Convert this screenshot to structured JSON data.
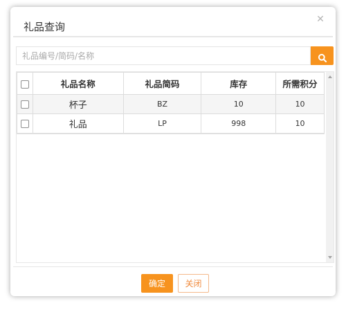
{
  "dialog": {
    "title": "礼品查询",
    "close_icon": "close-icon"
  },
  "search": {
    "placeholder": "礼品编号/简码/名称",
    "value": "",
    "button_icon": "search-icon"
  },
  "table": {
    "headers": {
      "name": "礼品名称",
      "code": "礼品简码",
      "stock": "库存",
      "points": "所需积分"
    },
    "rows": [
      {
        "name": "杯子",
        "code": "BZ",
        "stock": "10",
        "points": "10"
      },
      {
        "name": "礼品",
        "code": "LP",
        "stock": "998",
        "points": "10"
      }
    ]
  },
  "footer": {
    "ok_label": "确定",
    "close_label": "关闭"
  },
  "colors": {
    "accent": "#f7931e",
    "border": "#dcdcdc"
  }
}
